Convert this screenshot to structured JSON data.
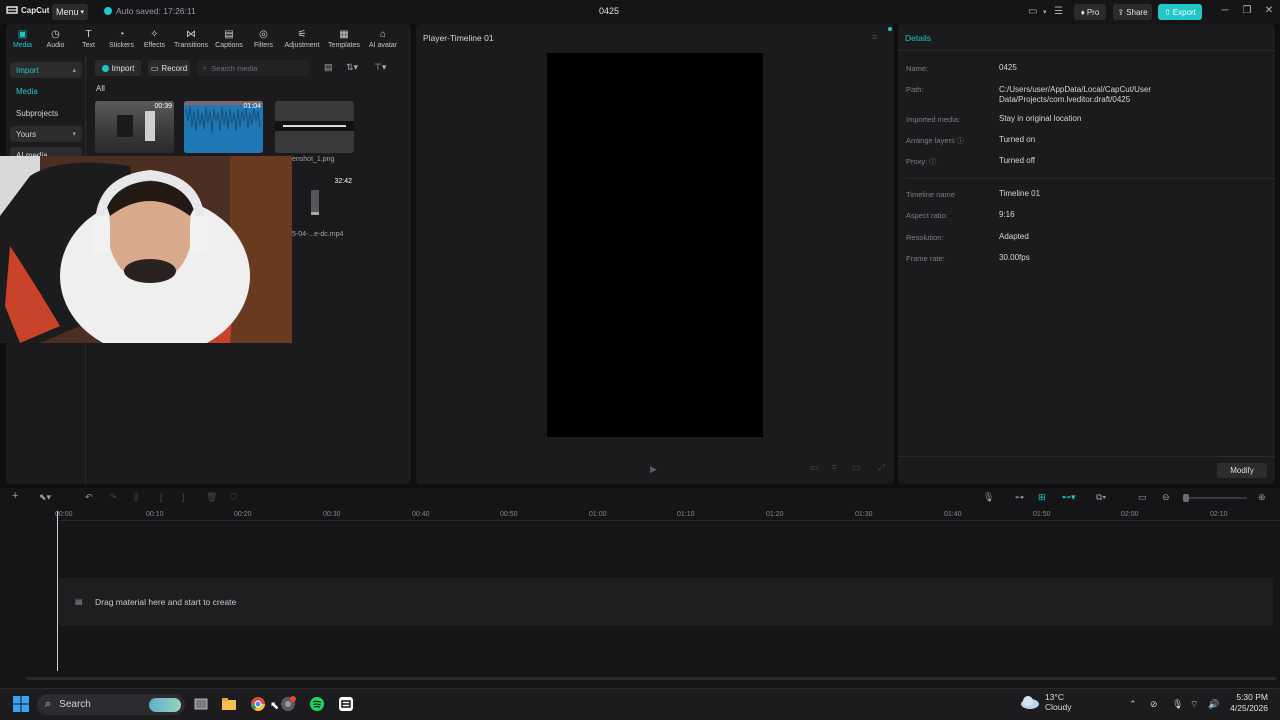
{
  "titlebar": {
    "logo": "CapCut",
    "menu": "Menu",
    "autosave": "Auto saved: 17:26:11",
    "project_title": "0425",
    "pro": "Pro",
    "share": "Share",
    "export": "Export"
  },
  "tool_tabs": [
    {
      "label": "Media",
      "icon": "media-icon"
    },
    {
      "label": "Audio",
      "icon": "audio-icon"
    },
    {
      "label": "Text",
      "icon": "text-icon"
    },
    {
      "label": "Stickers",
      "icon": "stickers-icon"
    },
    {
      "label": "Effects",
      "icon": "effects-icon"
    },
    {
      "label": "Transitions",
      "icon": "transitions-icon"
    },
    {
      "label": "Captions",
      "icon": "captions-icon"
    },
    {
      "label": "Filters",
      "icon": "filters-icon"
    },
    {
      "label": "Adjustment",
      "icon": "adjustment-icon"
    },
    {
      "label": "Templates",
      "icon": "templates-icon"
    },
    {
      "label": "AI avatar",
      "icon": "ai-avatar-icon"
    }
  ],
  "left_nav": {
    "import": "Import",
    "media": "Media",
    "subprojects": "Subprojects",
    "yours": "Yours",
    "ai_media": "AI media"
  },
  "media_toolbar": {
    "import": "Import",
    "record": "Record",
    "search_placeholder": "Search media",
    "filter_all": "All"
  },
  "media_items": [
    {
      "duration": "00:39",
      "name": ""
    },
    {
      "duration": "01:04",
      "name": ""
    },
    {
      "duration": "",
      "name": "enshot_1.png"
    },
    {
      "duration": "32:42",
      "name": "5-04-...e-dc.mp4"
    }
  ],
  "player": {
    "title": "Player-Timeline 01"
  },
  "details": {
    "heading": "Details",
    "rows": [
      {
        "label": "Name:",
        "value": "0425"
      },
      {
        "label": "Path:",
        "value": "C:/Users/user/AppData/Local/CapCut/User Data/Projects/com.lveditor.draft/0425"
      },
      {
        "label": "Imported media:",
        "value": "Stay in original location"
      },
      {
        "label": "Arrange layers",
        "value": "Turned on"
      },
      {
        "label": "Proxy:",
        "value": "Turned off"
      },
      {
        "label": "Timeline name",
        "value": "Timeline 01"
      },
      {
        "label": "Aspect ratio:",
        "value": "9:16"
      },
      {
        "label": "Resolution:",
        "value": "Adapted"
      },
      {
        "label": "Frame rate:",
        "value": "30.00fps"
      }
    ],
    "modify": "Modify"
  },
  "timeline": {
    "ruler": [
      "00:00",
      "00:10",
      "00:20",
      "00:30",
      "00:40",
      "00:50",
      "01:00",
      "01:10",
      "01:20",
      "01:30",
      "01:40",
      "01:50",
      "02:00",
      "02:10"
    ],
    "drag_hint": "Drag material here and start to create"
  },
  "taskbar": {
    "search": "Search",
    "weather_temp": "13°C",
    "weather_cond": "Cloudy",
    "time": "5:30 PM",
    "date": "4/25/2026"
  },
  "colors": {
    "accent": "#21c6c9",
    "panel": "#1b1b1d",
    "background": "#0f0f10"
  }
}
